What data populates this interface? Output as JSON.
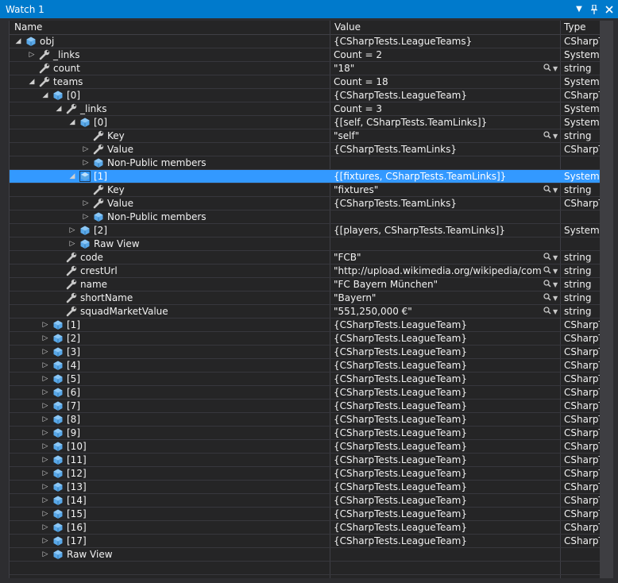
{
  "window": {
    "title": "Watch 1"
  },
  "columns": {
    "name": "Name",
    "value": "Value",
    "type": "Type"
  },
  "colors": {
    "titlebar": "#007acc",
    "selection": "#3399ff",
    "object_icon": "#59a8e8",
    "wrench_icon": "#c8c8c8"
  },
  "rows": [
    {
      "indent": 0,
      "expander": "expanded",
      "icon": "object",
      "name": "obj",
      "value": "{CSharpTests.LeagueTeams}",
      "type": "CSharpT"
    },
    {
      "indent": 1,
      "expander": "collapsed",
      "icon": "wrench",
      "name": "_links",
      "value": "Count = 2",
      "type": "System.C"
    },
    {
      "indent": 1,
      "expander": "none",
      "icon": "wrench",
      "name": "count",
      "value": "\"18\"",
      "type": "string",
      "viewer": true
    },
    {
      "indent": 1,
      "expander": "expanded",
      "icon": "wrench",
      "name": "teams",
      "value": "Count = 18",
      "type": "System.C"
    },
    {
      "indent": 2,
      "expander": "expanded",
      "icon": "object",
      "name": "[0]",
      "value": "{CSharpTests.LeagueTeam}",
      "type": "CSharpT"
    },
    {
      "indent": 3,
      "expander": "expanded",
      "icon": "wrench",
      "name": "_links",
      "value": "Count = 3",
      "type": "System.C"
    },
    {
      "indent": 4,
      "expander": "expanded",
      "icon": "object",
      "name": "[0]",
      "value": "{[self, CSharpTests.TeamLinks]}",
      "type": "System.C"
    },
    {
      "indent": 5,
      "expander": "none",
      "icon": "wrench",
      "name": "Key",
      "value": "\"self\"",
      "type": "string",
      "viewer": true
    },
    {
      "indent": 5,
      "expander": "collapsed",
      "icon": "wrench",
      "name": "Value",
      "value": "{CSharpTests.TeamLinks}",
      "type": "CSharpT"
    },
    {
      "indent": 5,
      "expander": "collapsed",
      "icon": "object",
      "name": "Non-Public members",
      "value": "",
      "type": ""
    },
    {
      "indent": 4,
      "expander": "expanded",
      "icon": "object-outline",
      "name": "[1]",
      "value": "{[fixtures, CSharpTests.TeamLinks]}",
      "type": "System.C",
      "selected": true
    },
    {
      "indent": 5,
      "expander": "none",
      "icon": "wrench",
      "name": "Key",
      "value": "\"fixtures\"",
      "type": "string",
      "viewer": true
    },
    {
      "indent": 5,
      "expander": "collapsed",
      "icon": "wrench",
      "name": "Value",
      "value": "{CSharpTests.TeamLinks}",
      "type": "CSharpT"
    },
    {
      "indent": 5,
      "expander": "collapsed",
      "icon": "object",
      "name": "Non-Public members",
      "value": "",
      "type": ""
    },
    {
      "indent": 4,
      "expander": "collapsed",
      "icon": "object",
      "name": "[2]",
      "value": "{[players, CSharpTests.TeamLinks]}",
      "type": "System.C"
    },
    {
      "indent": 4,
      "expander": "collapsed",
      "icon": "object",
      "name": "Raw View",
      "value": "",
      "type": ""
    },
    {
      "indent": 3,
      "expander": "none",
      "icon": "wrench",
      "name": "code",
      "value": "\"FCB\"",
      "type": "string",
      "viewer": true
    },
    {
      "indent": 3,
      "expander": "none",
      "icon": "wrench",
      "name": "crestUrl",
      "value": "\"http://upload.wikimedia.org/wikipedia/commons",
      "type": "string",
      "viewer": true
    },
    {
      "indent": 3,
      "expander": "none",
      "icon": "wrench",
      "name": "name",
      "value": "\"FC Bayern München\"",
      "type": "string",
      "viewer": true
    },
    {
      "indent": 3,
      "expander": "none",
      "icon": "wrench",
      "name": "shortName",
      "value": "\"Bayern\"",
      "type": "string",
      "viewer": true
    },
    {
      "indent": 3,
      "expander": "none",
      "icon": "wrench",
      "name": "squadMarketValue",
      "value": "\"551,250,000 €\"",
      "type": "string",
      "viewer": true
    },
    {
      "indent": 2,
      "expander": "collapsed",
      "icon": "object",
      "name": "[1]",
      "value": "{CSharpTests.LeagueTeam}",
      "type": "CSharpT"
    },
    {
      "indent": 2,
      "expander": "collapsed",
      "icon": "object",
      "name": "[2]",
      "value": "{CSharpTests.LeagueTeam}",
      "type": "CSharpT"
    },
    {
      "indent": 2,
      "expander": "collapsed",
      "icon": "object",
      "name": "[3]",
      "value": "{CSharpTests.LeagueTeam}",
      "type": "CSharpT"
    },
    {
      "indent": 2,
      "expander": "collapsed",
      "icon": "object",
      "name": "[4]",
      "value": "{CSharpTests.LeagueTeam}",
      "type": "CSharpT"
    },
    {
      "indent": 2,
      "expander": "collapsed",
      "icon": "object",
      "name": "[5]",
      "value": "{CSharpTests.LeagueTeam}",
      "type": "CSharpT"
    },
    {
      "indent": 2,
      "expander": "collapsed",
      "icon": "object",
      "name": "[6]",
      "value": "{CSharpTests.LeagueTeam}",
      "type": "CSharpT"
    },
    {
      "indent": 2,
      "expander": "collapsed",
      "icon": "object",
      "name": "[7]",
      "value": "{CSharpTests.LeagueTeam}",
      "type": "CSharpT"
    },
    {
      "indent": 2,
      "expander": "collapsed",
      "icon": "object",
      "name": "[8]",
      "value": "{CSharpTests.LeagueTeam}",
      "type": "CSharpT"
    },
    {
      "indent": 2,
      "expander": "collapsed",
      "icon": "object",
      "name": "[9]",
      "value": "{CSharpTests.LeagueTeam}",
      "type": "CSharpT"
    },
    {
      "indent": 2,
      "expander": "collapsed",
      "icon": "object",
      "name": "[10]",
      "value": "{CSharpTests.LeagueTeam}",
      "type": "CSharpT"
    },
    {
      "indent": 2,
      "expander": "collapsed",
      "icon": "object",
      "name": "[11]",
      "value": "{CSharpTests.LeagueTeam}",
      "type": "CSharpT"
    },
    {
      "indent": 2,
      "expander": "collapsed",
      "icon": "object",
      "name": "[12]",
      "value": "{CSharpTests.LeagueTeam}",
      "type": "CSharpT"
    },
    {
      "indent": 2,
      "expander": "collapsed",
      "icon": "object",
      "name": "[13]",
      "value": "{CSharpTests.LeagueTeam}",
      "type": "CSharpT"
    },
    {
      "indent": 2,
      "expander": "collapsed",
      "icon": "object",
      "name": "[14]",
      "value": "{CSharpTests.LeagueTeam}",
      "type": "CSharpT"
    },
    {
      "indent": 2,
      "expander": "collapsed",
      "icon": "object",
      "name": "[15]",
      "value": "{CSharpTests.LeagueTeam}",
      "type": "CSharpT"
    },
    {
      "indent": 2,
      "expander": "collapsed",
      "icon": "object",
      "name": "[16]",
      "value": "{CSharpTests.LeagueTeam}",
      "type": "CSharpT"
    },
    {
      "indent": 2,
      "expander": "collapsed",
      "icon": "object",
      "name": "[17]",
      "value": "{CSharpTests.LeagueTeam}",
      "type": "CSharpT"
    },
    {
      "indent": 2,
      "expander": "collapsed",
      "icon": "object",
      "name": "Raw View",
      "value": "",
      "type": ""
    },
    {
      "indent": 0,
      "expander": "none",
      "icon": "none",
      "name": "",
      "value": "",
      "type": ""
    }
  ]
}
